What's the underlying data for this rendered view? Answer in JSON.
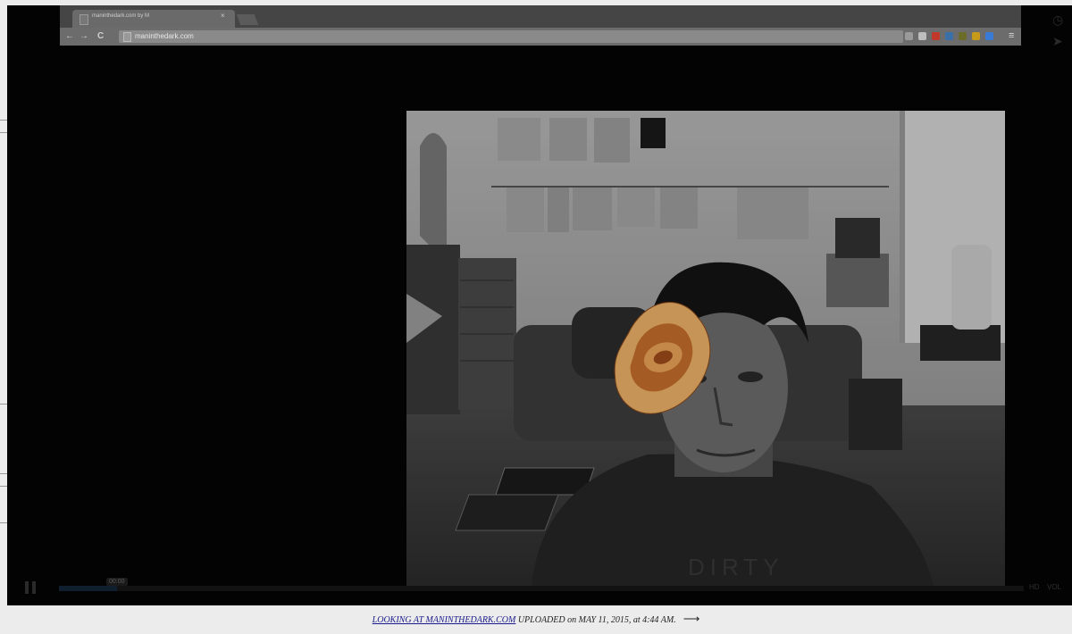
{
  "browser": {
    "tab_title": "maninthedark.com by M",
    "tab_close": "×",
    "url": "maninthedark.com",
    "nav_back": "←",
    "nav_forward": "→",
    "nav_reload": "C",
    "menu_glyph": "≡",
    "extensions": [
      {
        "name": "image-icon",
        "color": "#9a9a9a"
      },
      {
        "name": "star-icon",
        "color": "#bdbdbd"
      },
      {
        "name": "adblock-icon",
        "color": "#c0392b"
      },
      {
        "name": "ghostery-icon",
        "color": "#3b6fa8"
      },
      {
        "name": "evernote-icon",
        "color": "#6b6b2a"
      },
      {
        "name": "pocket-icon",
        "color": "#c79a1a"
      },
      {
        "name": "tampermonkey-icon",
        "color": "#3a7bd5"
      }
    ]
  },
  "player": {
    "elapsed_time": "00:00",
    "progress": 0.06,
    "hd_label": "HD",
    "volume_label": "VOL"
  },
  "caption": {
    "link_text": "LOOKING AT MANINTHEDARK.COM",
    "middle_text": " UPLOADED on ",
    "date_text": "MAY 11, 2015, at 4:44 AM.",
    "arrow": "⟶"
  },
  "colors": {
    "accent_orange": "#e08a3c",
    "link_blue": "#1a1a8c"
  }
}
